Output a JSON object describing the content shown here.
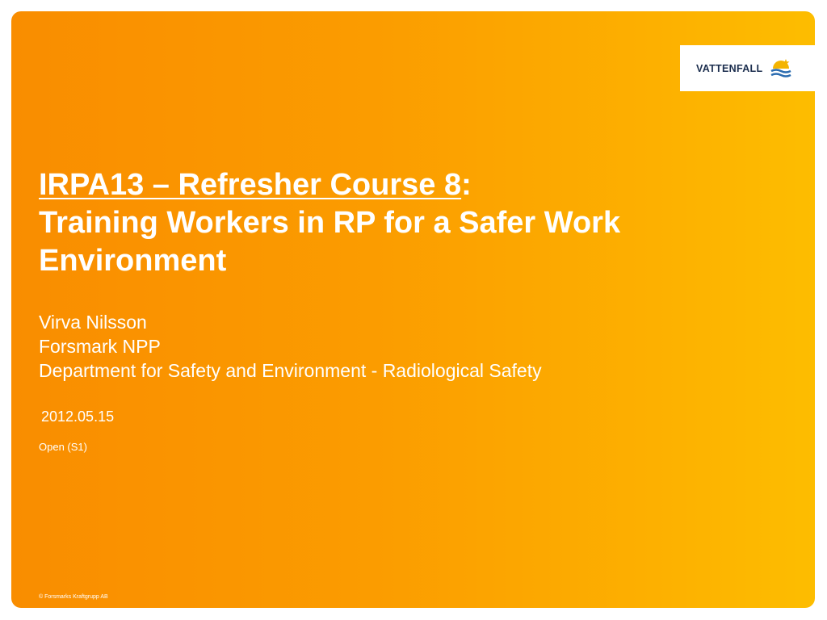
{
  "logo": {
    "text": "VATTENFALL",
    "colors": {
      "navy": "#1c2e4e",
      "blue": "#2b6cb0",
      "yellow": "#f4b400"
    }
  },
  "title": {
    "course": "IRPA13 – Refresher Course 8",
    "colon": ":",
    "line2": "Training Workers in RP for a Safer Work",
    "line3": "Environment"
  },
  "subtitle": {
    "name": "Virva Nilsson",
    "org": "Forsmark NPP",
    "department": "Department for Safety and Environment - Radiological Safety"
  },
  "date": "2012.05.15",
  "classification": "Open (S1)",
  "copyright": "© Forsmarks Kraftgrupp AB",
  "colors": {
    "gradient_start": "#f98d00",
    "gradient_end": "#fdbd00",
    "text": "#ffffff"
  }
}
